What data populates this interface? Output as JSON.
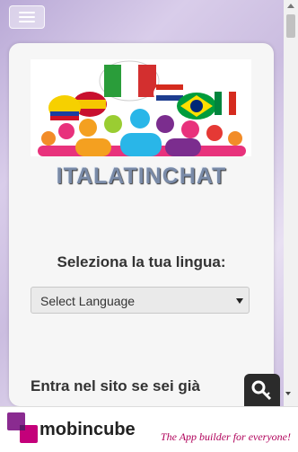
{
  "app": {
    "name": "ITALATINCHAT"
  },
  "menu": {
    "icon": "hamburger-icon"
  },
  "content": {
    "language_prompt": "Seleziona la tua lingua:",
    "language_select": {
      "selected": "Select Language"
    },
    "login_prompt": "Entra nel sito se sei già"
  },
  "floating_button": {
    "icon": "key-icon"
  },
  "footer": {
    "brand": "mobincube",
    "tagline": "The App builder for everyone!"
  },
  "colors": {
    "accent": "#b0005a",
    "title": "#7a8ba8"
  }
}
